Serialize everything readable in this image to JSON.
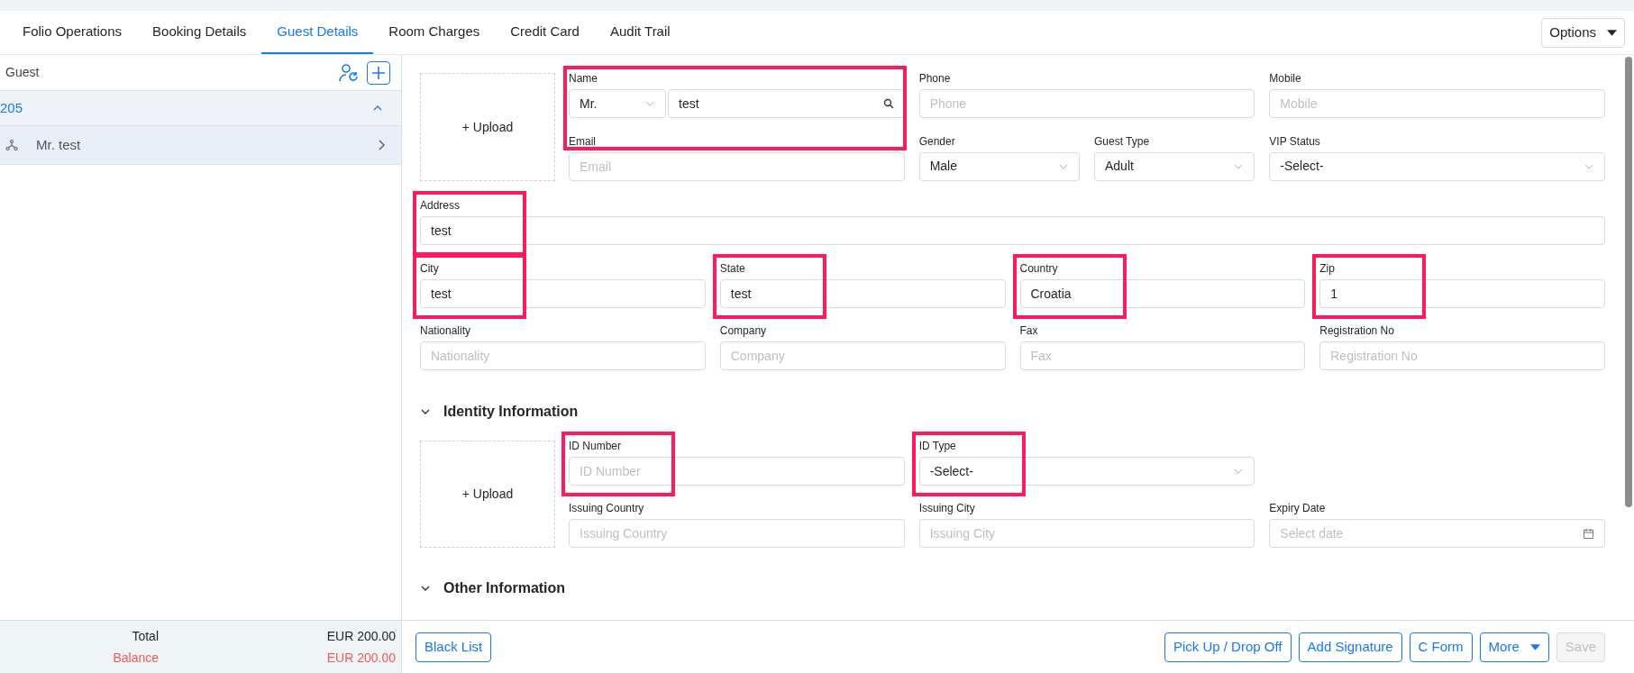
{
  "tabs": [
    {
      "label": "Folio Operations",
      "selected": false
    },
    {
      "label": "Booking Details",
      "selected": false
    },
    {
      "label": "Guest Details",
      "selected": true
    },
    {
      "label": "Room Charges",
      "selected": false
    },
    {
      "label": "Credit Card",
      "selected": false
    },
    {
      "label": "Audit Trail",
      "selected": false
    }
  ],
  "options_button": "Options",
  "guest_panel": {
    "title": "Guest",
    "rows": [
      {
        "kind": "room",
        "label": "205",
        "expanded": true
      },
      {
        "kind": "guest",
        "label": "Mr. test"
      }
    ]
  },
  "totals": [
    {
      "kind": "total",
      "label": "Total",
      "value": "EUR 200.00"
    },
    {
      "kind": "balance",
      "label": "Balance",
      "value": "EUR 200.00"
    }
  ],
  "guest_info": {
    "upload": "+ Upload",
    "top_fields": [
      {
        "kind": "name",
        "label": "Name",
        "title": "Mr.",
        "value": "test",
        "highlighted": true
      },
      {
        "kind": "input",
        "label": "Phone",
        "placeholder": "Phone",
        "highlighted": false
      },
      {
        "kind": "input",
        "label": "Mobile",
        "placeholder": "Mobile",
        "highlighted": false
      },
      {
        "kind": "input",
        "label": "Email",
        "placeholder": "Email",
        "highlighted": false
      },
      {
        "kind": "select",
        "label": "Gender",
        "value": "Male",
        "highlighted": false
      },
      {
        "kind": "select",
        "label": "Guest Type",
        "value": "Adult",
        "highlighted": false
      },
      {
        "kind": "select",
        "label": "VIP Status",
        "value": "-Select-",
        "highlighted": false
      }
    ],
    "address": {
      "kind": "input",
      "label": "Address",
      "value": "test",
      "highlighted": true
    },
    "grid_fields": [
      {
        "kind": "input",
        "label": "City",
        "value": "test",
        "highlighted": true
      },
      {
        "kind": "input",
        "label": "State",
        "value": "test",
        "highlighted": true
      },
      {
        "kind": "input",
        "label": "Country",
        "value": "Croatia",
        "highlighted": true
      },
      {
        "kind": "input",
        "label": "Zip",
        "value": "1",
        "highlighted": true
      },
      {
        "kind": "input",
        "label": "Nationality",
        "placeholder": "Nationality",
        "highlighted": false
      },
      {
        "kind": "input",
        "label": "Company",
        "placeholder": "Company",
        "highlighted": false
      },
      {
        "kind": "input",
        "label": "Fax",
        "placeholder": "Fax",
        "highlighted": false
      },
      {
        "kind": "input",
        "label": "Registration No",
        "placeholder": "Registration No",
        "highlighted": false
      }
    ]
  },
  "identity": {
    "title": "Identity Information",
    "expanded": true,
    "upload": "+ Upload",
    "row_1": [
      {
        "kind": "input",
        "label": "ID Number",
        "placeholder": "ID Number",
        "highlighted": true
      },
      {
        "kind": "select",
        "label": "ID Type",
        "value": "-Select-",
        "highlighted": true
      }
    ],
    "row_2": [
      {
        "kind": "input",
        "label": "Issuing Country",
        "placeholder": "Issuing Country",
        "highlighted": false
      },
      {
        "kind": "input",
        "label": "Issuing City",
        "placeholder": "Issuing City",
        "highlighted": false
      },
      {
        "kind": "date",
        "label": "Expiry Date",
        "placeholder": "Select date",
        "highlighted": false
      }
    ]
  },
  "other": {
    "title": "Other Information",
    "expanded": true
  },
  "footer": {
    "left_button": "Black List",
    "buttons": [
      {
        "label": "Pick Up / Drop Off",
        "dropdown": false,
        "disabled": false
      },
      {
        "label": "Add Signature",
        "dropdown": false,
        "disabled": false
      },
      {
        "label": "C Form",
        "dropdown": false,
        "disabled": false
      },
      {
        "label": "More",
        "dropdown": true,
        "disabled": false
      },
      {
        "label": "Save",
        "dropdown": false,
        "disabled": true
      }
    ]
  }
}
